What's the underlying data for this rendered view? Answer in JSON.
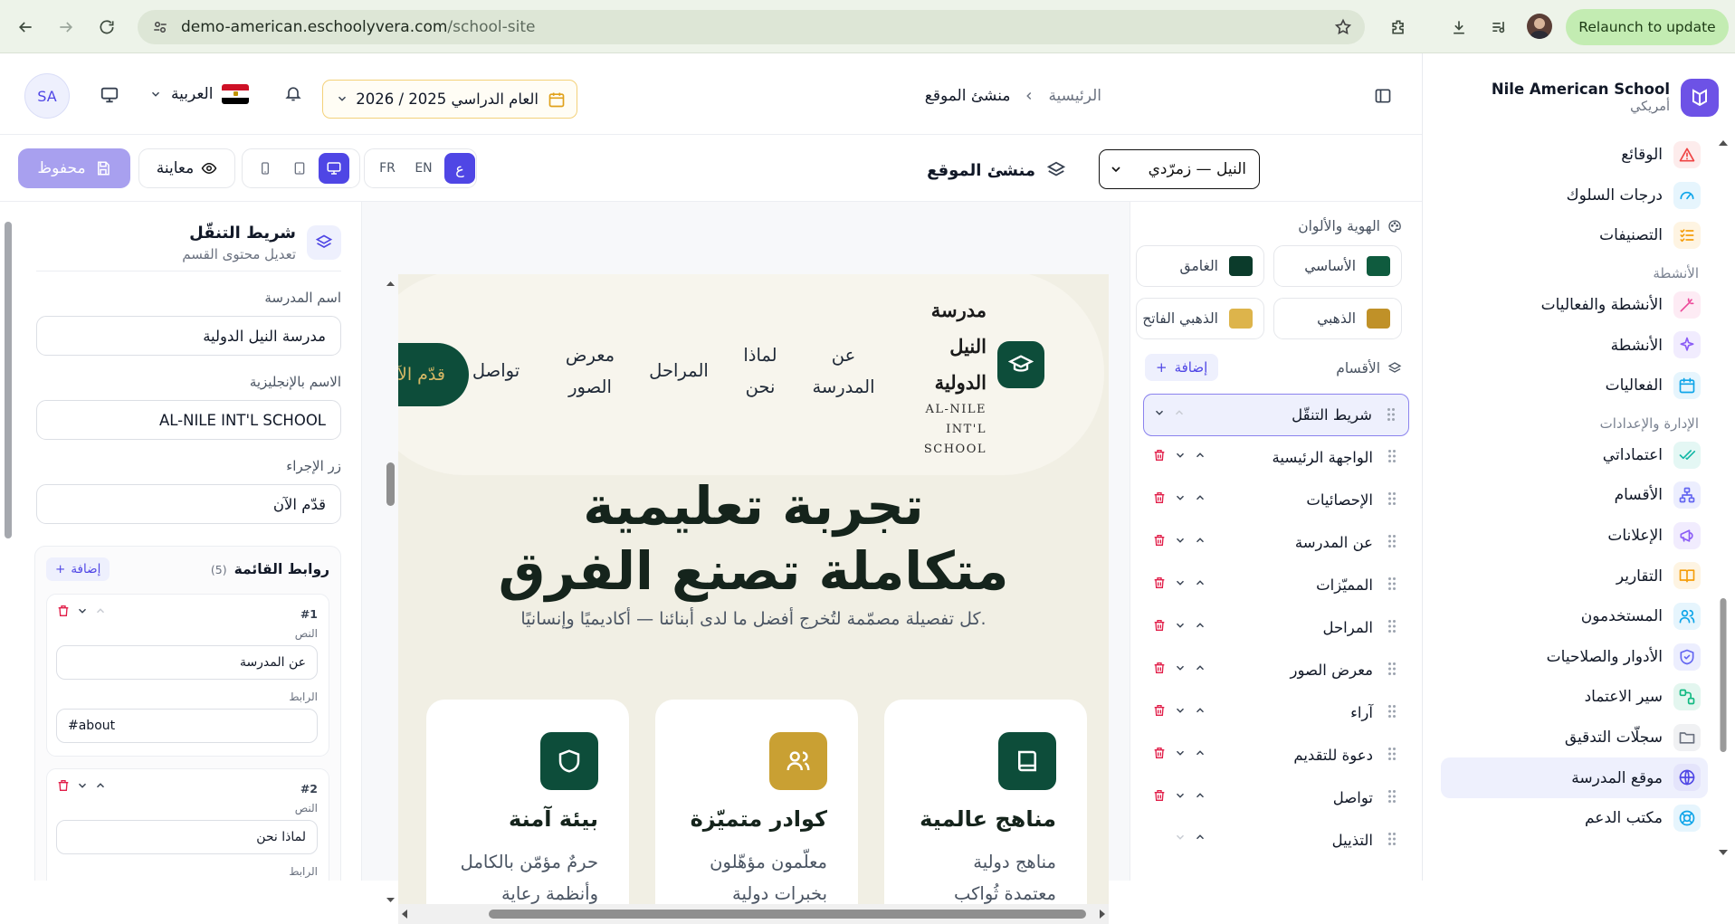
{
  "browser": {
    "url_host": "demo-american.eschoolyvera.com",
    "url_path": "/school-site",
    "relaunch_label": "Relaunch to update"
  },
  "sidebar": {
    "school_name": "Nile American School",
    "school_type": "أمريكي",
    "items": [
      {
        "label": "الوقائع",
        "icon": "alert-icon",
        "color": "#ef4444",
        "bg": "#fdecec"
      },
      {
        "label": "درجات السلوك",
        "icon": "gauge-icon",
        "color": "#0ea5e9",
        "bg": "#e6f5fd"
      },
      {
        "label": "التصنيفات",
        "icon": "list-check-icon",
        "color": "#f59e0b",
        "bg": "#fef4e2"
      }
    ],
    "section_activities": "الأنشطة",
    "items_activities": [
      {
        "label": "الأنشطة والفعاليات",
        "icon": "wand-icon",
        "color": "#ec4899",
        "bg": "#fdebf4"
      },
      {
        "label": "الأنشطة",
        "icon": "sparkle-icon",
        "color": "#8b5cf6",
        "bg": "#f1ecfe"
      },
      {
        "label": "الفعاليات",
        "icon": "calendar-icon",
        "color": "#0ea5e9",
        "bg": "#e6f5fd"
      }
    ],
    "section_admin": "الإدارة والإعدادات",
    "items_admin": [
      {
        "label": "اعتماداتي",
        "icon": "check-icon",
        "color": "#14b8a6",
        "bg": "#e4f7f4"
      },
      {
        "label": "الأقسام",
        "icon": "org-icon",
        "color": "#6366f1",
        "bg": "#eceefe"
      },
      {
        "label": "الإعلانات",
        "icon": "megaphone-icon",
        "color": "#8b5cf6",
        "bg": "#f1ecfe"
      },
      {
        "label": "التقارير",
        "icon": "book-icon",
        "color": "#f59e0b",
        "bg": "#fef4e2"
      },
      {
        "label": "المستخدمون",
        "icon": "users-icon",
        "color": "#0ea5e9",
        "bg": "#e6f5fd"
      },
      {
        "label": "الأدوار والصلاحيات",
        "icon": "shield-icon",
        "color": "#6366f1",
        "bg": "#eceefe"
      },
      {
        "label": "سير الاعتماد",
        "icon": "workflow-icon",
        "color": "#10b981",
        "bg": "#e3f6ef"
      },
      {
        "label": "سجلّات التدقيق",
        "icon": "folder-icon",
        "color": "#6b7280",
        "bg": "#f0f1f3"
      },
      {
        "label": "موقع المدرسة",
        "icon": "globe-icon",
        "color": "#4f46e5",
        "bg": "#e4e4fb",
        "active": true
      },
      {
        "label": "مكتب الدعم",
        "icon": "lifebuoy-icon",
        "color": "#0ea5e9",
        "bg": "#e6f5fd"
      }
    ]
  },
  "header": {
    "avatar_initials": "SA",
    "language": "العربية",
    "academic_year": "العام الدراسي 2025 / 2026",
    "breadcrumb_home": "الرئيسية",
    "breadcrumb_current": "منشئ الموقع"
  },
  "toolbar": {
    "title": "منشئ الموقع",
    "theme_select": "النيل — زمرّدي",
    "lang_ar": "ع",
    "lang_en": "EN",
    "lang_fr": "FR",
    "preview_label": "معاينة",
    "saved_label": "محفوظ"
  },
  "editor": {
    "title": "شريط التنقّل",
    "subtitle": "تعديل محتوى القسم",
    "school_name_label": "اسم المدرسة",
    "school_name_value": "مدرسة النيل الدولية",
    "english_name_label": "الاسم بالإنجليزية",
    "english_name_value": "AL-NILE INT'L SCHOOL",
    "cta_label": "زر الإجراء",
    "cta_value": "قدّم الآن",
    "links_title": "روابط القائمة",
    "links_count": "(5)",
    "add_label": "إضافة",
    "links": [
      {
        "num": "#1",
        "text_label": "النص",
        "text": "عن المدرسة",
        "link_label": "الرابط",
        "href": "#about"
      },
      {
        "num": "#2",
        "text_label": "النص",
        "text": "لماذا نحن",
        "link_label": "الرابط",
        "href": ""
      }
    ]
  },
  "preview": {
    "school_name": "مدرسة النيل الدولية",
    "school_name_en": "AL-NILE INT'L SCHOOL",
    "nav_links": [
      "عن المدرسة",
      "لماذا نحن",
      "المراحل",
      "معرض الصور",
      "تواصل"
    ],
    "cta": "قدّم الآن",
    "hero_line1": "تجربة تعليمية",
    "hero_line2": "متكاملة تصنع الفرق",
    "hero_sub": "كل تفصيلة مصمّمة لتُخرج أفضل ما لدى أبنائنا — أكاديميًا وإنسانيًا.",
    "cards": [
      {
        "title": "مناهج عالمية",
        "line1": "مناهج دولية",
        "line2": "معتمدة ثُواكب",
        "icon": "book-icon",
        "color": "#0d4d3a"
      },
      {
        "title": "كوادر متميّزة",
        "line1": "معلّمون مؤهّلون",
        "line2": "بخبرات دولية",
        "icon": "users-icon",
        "color": "#c9a033"
      },
      {
        "title": "بيئة آمنة",
        "line1": "حرمٌ مؤمّن بالكامل",
        "line2": "وأنظمة رعاية",
        "icon": "shield-icon",
        "color": "#0d4d3a"
      }
    ]
  },
  "identity": {
    "title": "الهوية والألوان",
    "colors": [
      {
        "label": "الأساسي",
        "hex": "#0f5b3e"
      },
      {
        "label": "الغامق",
        "hex": "#0b3b2b"
      },
      {
        "label": "الذهبي",
        "hex": "#c09128"
      },
      {
        "label": "الذهبي الفاتح",
        "hex": "#ddb44b"
      }
    ]
  },
  "sections": {
    "title": "الأقسام",
    "add_label": "إضافة",
    "items": [
      {
        "label": "شريط التنقّل",
        "active": true,
        "deletable": false
      },
      {
        "label": "الواجهة الرئيسية",
        "deletable": true
      },
      {
        "label": "الإحصائيات",
        "deletable": true
      },
      {
        "label": "عن المدرسة",
        "deletable": true
      },
      {
        "label": "المميّزات",
        "deletable": true
      },
      {
        "label": "المراحل",
        "deletable": true
      },
      {
        "label": "معرض الصور",
        "deletable": true
      },
      {
        "label": "آراء",
        "deletable": true
      },
      {
        "label": "دعوة للتقديم",
        "deletable": true
      },
      {
        "label": "تواصل",
        "deletable": true
      },
      {
        "label": "التذييل",
        "deletable": false
      }
    ]
  }
}
